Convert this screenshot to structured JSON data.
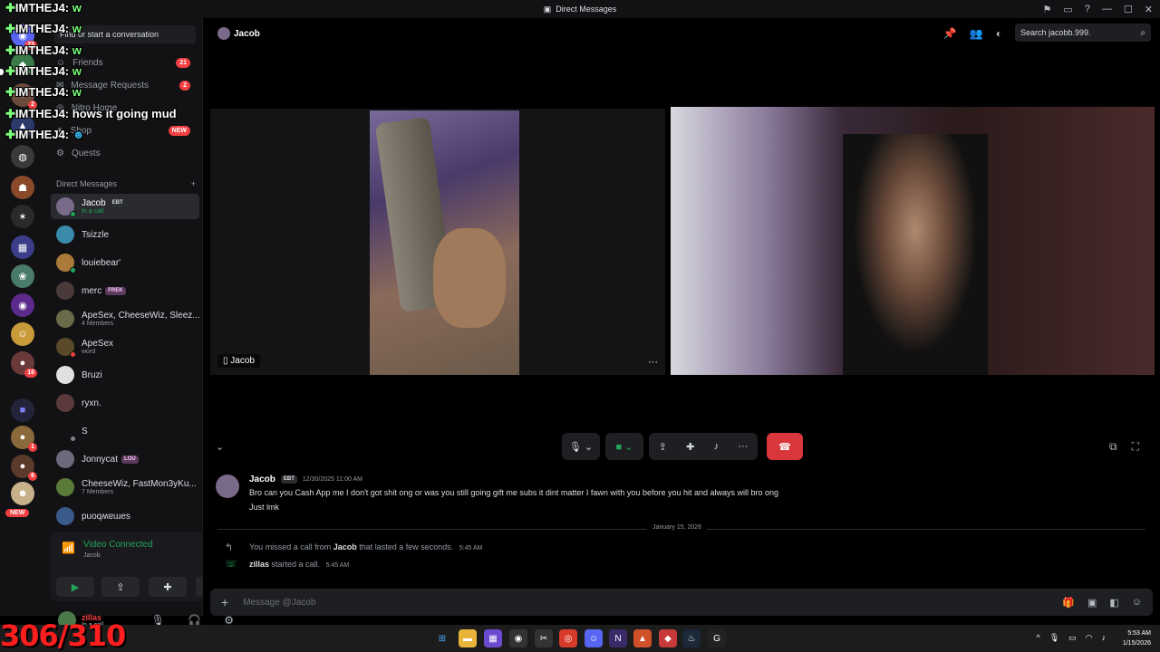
{
  "window": {
    "title": "Direct Messages"
  },
  "stream_overlay": {
    "chat": [
      {
        "user": "IMTHEJ4:",
        "msg": "w"
      },
      {
        "user": "IMTHEJ4:",
        "msg": "w"
      },
      {
        "user": "IMTHEJ4:",
        "msg": "w"
      },
      {
        "user": "IMTHEJ4:",
        "msg": "w"
      },
      {
        "user": "IMTHEJ4:",
        "msg": "w"
      },
      {
        "user": "IMTHEJ4:",
        "msg": "hows it going mud"
      },
      {
        "user": "IMTHEJ4:",
        "msg": ""
      }
    ],
    "counter": "306/310"
  },
  "server_badges": [
    "23",
    "2",
    "16",
    "1",
    "6",
    "NEW"
  ],
  "sidebar": {
    "find_placeholder": "Find or start a conversation",
    "nav": [
      {
        "label": "Friends",
        "count": "21"
      },
      {
        "label": "Message Requests",
        "count": "2"
      },
      {
        "label": "Nitro Home",
        "count": ""
      },
      {
        "label": "Shop",
        "count": "NEW"
      },
      {
        "label": "Quests",
        "count": ""
      }
    ],
    "dm_header": "Direct Messages",
    "dm_add": "+",
    "dms": [
      {
        "name": "Jacob",
        "tag": "EBT",
        "sub": "In a call"
      },
      {
        "name": "Tsizzle",
        "tag": "",
        "sub": ""
      },
      {
        "name": "louiebear'",
        "tag": "",
        "sub": ""
      },
      {
        "name": "merc",
        "tag": "FREK",
        "sub": ""
      },
      {
        "name": "ApeSex, CheeseWiz, Sleez...",
        "tag": "",
        "sub": "4 Members"
      },
      {
        "name": "ApeSex",
        "tag": "",
        "sub": "word"
      },
      {
        "name": "Bruzi",
        "tag": "",
        "sub": ""
      },
      {
        "name": "ryxn.",
        "tag": "",
        "sub": ""
      },
      {
        "name": "S",
        "tag": "",
        "sub": ""
      },
      {
        "name": "Jonnycat",
        "tag": "LOU",
        "sub": ""
      },
      {
        "name": "CheeseWiz, FastMon3yKu...",
        "tag": "",
        "sub": "7 Members"
      },
      {
        "name": "puoqʍɐɯes",
        "tag": "",
        "sub": ""
      }
    ]
  },
  "voice": {
    "status": "Video Connected",
    "channel": "Jacob"
  },
  "user_panel": {
    "name": "zillas",
    "status": "In a call"
  },
  "header": {
    "name": "Jacob",
    "search_placeholder": "Search jacobb.999."
  },
  "call": {
    "tile_label": "Jacob"
  },
  "messages": {
    "first": {
      "author": "Jacob",
      "tag": "EBT",
      "timestamp": "12/30/2025 11:00 AM",
      "lines": [
        "Bro can you Cash App me I don't got shit ong or was you still going gift me subs it dint matter I fawn with you before you hit and always will bro ong",
        "Just lmk"
      ]
    },
    "divider": "January 15, 2026",
    "sys1": {
      "pre": "You missed a call from ",
      "who": "Jacob",
      "post": " that lasted a few seconds.",
      "time": "5:45 AM"
    },
    "sys2": {
      "who": "zillas",
      "post": " started a call.",
      "time": "5:45 AM"
    }
  },
  "composer": {
    "placeholder": "Message @Jacob"
  },
  "taskbar": {
    "time": "5:53 AM",
    "date": "1/15/2026"
  }
}
